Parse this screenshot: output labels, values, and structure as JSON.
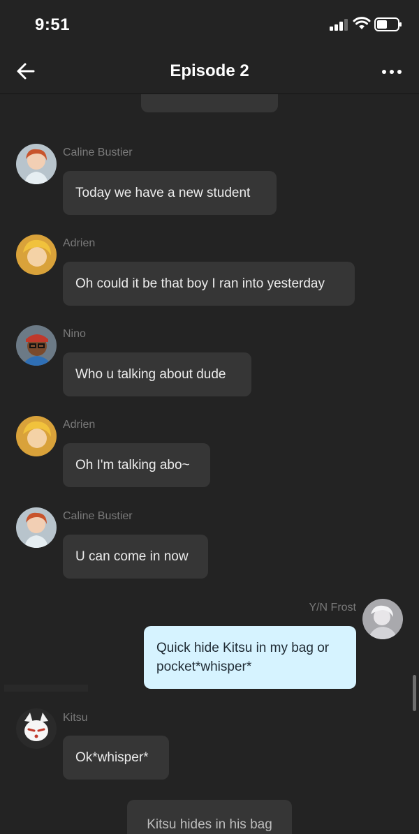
{
  "status": {
    "time": "9:51"
  },
  "header": {
    "title": "Episode 2"
  },
  "messages": [
    {
      "sender": "Caline Bustier",
      "text": "Today we have a new student"
    },
    {
      "sender": "Adrien",
      "text": "Oh could it be that boy I ran into yesterday"
    },
    {
      "sender": "Nino",
      "text": "Who u talking about dude"
    },
    {
      "sender": "Adrien",
      "text": "Oh I'm talking abo~"
    },
    {
      "sender": "Caline Bustier",
      "text": "U can come in now"
    },
    {
      "sender": "Y/N Frost",
      "text": "Quick hide Kitsu in my bag or pocket*whisper*"
    },
    {
      "sender": "Kitsu",
      "text": "Ok*whisper*"
    }
  ],
  "narration": {
    "text": "Kitsu hides in his bag"
  },
  "colors": {
    "background": "#232323",
    "bubble": "#363636",
    "outgoing_bubble": "#d6f3ff",
    "sender_name": "#7a7a7a"
  },
  "icons": [
    "back-arrow-icon",
    "more-options-icon",
    "signal-icon",
    "wifi-icon",
    "battery-icon"
  ]
}
